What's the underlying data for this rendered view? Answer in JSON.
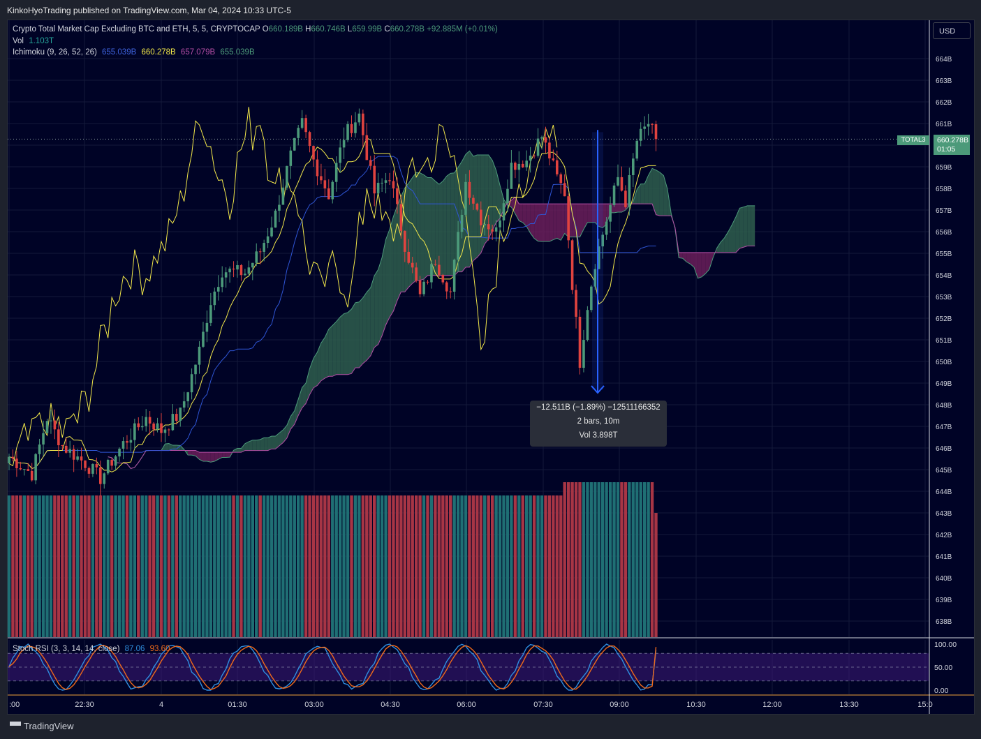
{
  "header": {
    "published": "KinkoHyoTrading published on TradingView.com, Mar 04, 2024 10:33 UTC-5"
  },
  "legend": {
    "symbol": "Crypto Total Market Cap Excluding BTC and ETH, 5, 5, CRYPTOCAP",
    "ohlc": [
      {
        "k": "O",
        "v": "660.189B"
      },
      {
        "k": "H",
        "v": "660.746B"
      },
      {
        "k": "L",
        "v": "659.99B"
      },
      {
        "k": "C",
        "v": "660.278B"
      }
    ],
    "change": "+92.885M (+0.01%)",
    "vol_label": "Vol",
    "vol_value": "1.103T",
    "ichimoku_label": "Ichimoku (9, 26, 52, 26)",
    "ichimoku_values": [
      "655.039B",
      "660.278B",
      "657.079B",
      "655.039B"
    ],
    "stoch_label": "Stoch RSI (3, 3, 14, 14, close)",
    "stoch_values": [
      "87.06",
      "93.60"
    ]
  },
  "currency_button": "USD",
  "price_tag": {
    "symbol": "TOTAL3",
    "price": "660.278B",
    "countdown": "01:05"
  },
  "tooltip": {
    "line1": "−12.511B (−1.89%) −12511166352",
    "line2": "2 bars, 10m",
    "line3": "Vol 3.898T"
  },
  "brand": "TradingView",
  "colors": {
    "bg": "#000326",
    "up": "#4c9a7a",
    "down": "#e0433f",
    "tenkan": "#f2e84a",
    "kijun": "#2f56d6",
    "cloud_bear": "#6a1f5a",
    "cloud_bull": "#2e5e4e",
    "vol_up": "#1f6f74",
    "vol_down": "#a73545",
    "stoch_k": "#2f8fe0",
    "stoch_d": "#f06a1a",
    "measure": "#2962ff"
  },
  "chart_data": [
    {
      "type": "candlestick",
      "title": "Crypto Total Market Cap Excluding BTC and ETH, 5, 5, CRYPTOCAP",
      "y_ticks": [
        "664B",
        "663B",
        "662B",
        "661B",
        "660B",
        "659B",
        "658B",
        "657B",
        "656B",
        "655B",
        "654B",
        "653B",
        "652B",
        "651B",
        "650B",
        "649B",
        "648B",
        "647B",
        "646B",
        "645B",
        "644B",
        "643B",
        "642B",
        "641B",
        "640B",
        "639B",
        "638B"
      ],
      "x_ticks": [
        ":00",
        "22:30",
        "4",
        "01:30",
        "03:00",
        "04:30",
        "06:00",
        "07:30",
        "09:00",
        "10:30",
        "12:00",
        "13:30",
        "15:0"
      ],
      "ylim": [
        637.5,
        665
      ],
      "close_keypoints": [
        [
          0,
          645.6
        ],
        [
          6,
          644.8
        ],
        [
          10,
          647.4
        ],
        [
          14,
          646.1
        ],
        [
          20,
          645.3
        ],
        [
          24,
          644.6
        ],
        [
          30,
          646.2
        ],
        [
          36,
          647.4
        ],
        [
          40,
          646.8
        ],
        [
          45,
          647.6
        ],
        [
          50,
          650.5
        ],
        [
          53,
          652.8
        ],
        [
          56,
          654.2
        ],
        [
          62,
          654.1
        ],
        [
          66,
          655.1
        ],
        [
          70,
          656.8
        ],
        [
          72,
          658.2
        ],
        [
          74,
          659.5
        ],
        [
          77,
          661.0
        ],
        [
          80,
          659.3
        ],
        [
          84,
          657.7
        ],
        [
          88,
          660.4
        ],
        [
          92,
          661.4
        ],
        [
          96,
          657.8
        ],
        [
          100,
          658.6
        ],
        [
          104,
          655.4
        ],
        [
          108,
          653.0
        ],
        [
          112,
          654.7
        ],
        [
          116,
          653.2
        ],
        [
          120,
          658.3
        ],
        [
          124,
          656.6
        ],
        [
          128,
          656.0
        ],
        [
          132,
          659.1
        ],
        [
          136,
          659.3
        ],
        [
          140,
          660.4
        ],
        [
          142,
          659.5
        ],
        [
          144,
          658.5
        ],
        [
          146,
          657.8
        ],
        [
          148,
          653.6
        ],
        [
          150,
          650.0
        ],
        [
          152,
          652.6
        ],
        [
          154,
          654.6
        ],
        [
          158,
          657.2
        ],
        [
          160,
          658.5
        ],
        [
          162,
          657.4
        ],
        [
          165,
          660.2
        ],
        [
          168,
          661.0
        ],
        [
          170,
          660.28
        ]
      ],
      "volume": {
        "label": "Vol",
        "last": "1.103T",
        "recent_spike_start_bar": 146
      },
      "measurement": {
        "from": "660.7B",
        "to": "648.5B",
        "change": "−12.511B (−1.89%) −12511166352",
        "bars": "2 bars, 10m",
        "volume": "Vol 3.898T"
      }
    },
    {
      "type": "line",
      "title": "Stoch RSI (3, 3, 14, 14, close)",
      "y_ticks": [
        "100.00",
        "50.00",
        "0.00"
      ],
      "ylim": [
        -5,
        108
      ],
      "series": [
        {
          "name": "K",
          "last": "87.06"
        },
        {
          "name": "D",
          "last": "93.60"
        }
      ]
    }
  ]
}
